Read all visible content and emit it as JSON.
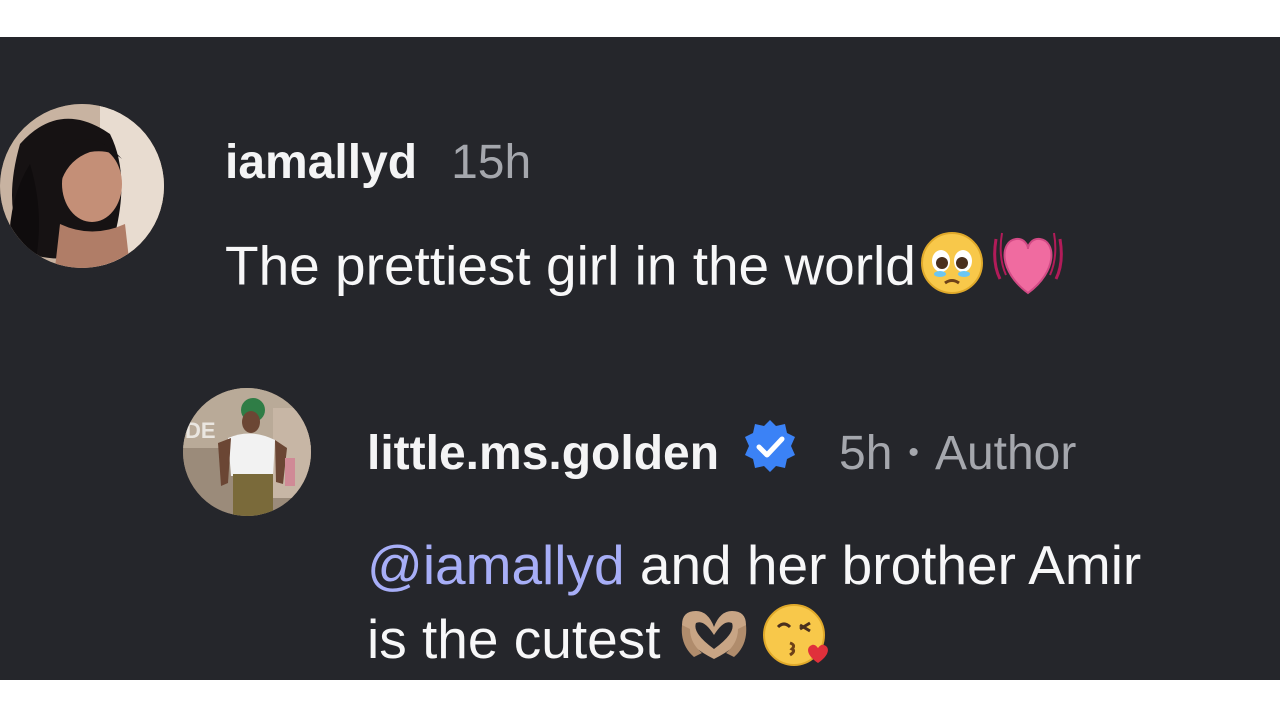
{
  "comments": [
    {
      "username": "iamallyd",
      "time": "15h",
      "text": "The prettiest girl in the world",
      "emojis": [
        "pleading-face-emoji",
        "beating-heart-emoji"
      ]
    },
    {
      "username": "little.ms.golden",
      "verified": true,
      "time": "5h",
      "separator": "•",
      "role": "Author",
      "mention": "@iamallyd",
      "text_line1": " and her brother Amir",
      "text_line2": "is the cutest ",
      "emojis": [
        "heart-hands-emoji",
        "kissing-heart-emoji"
      ]
    }
  ],
  "colors": {
    "background": "#25262b",
    "username": "#f4f4f5",
    "meta": "#a5a7ad",
    "mention": "#a7aef7",
    "verified": "#3b82f6"
  }
}
